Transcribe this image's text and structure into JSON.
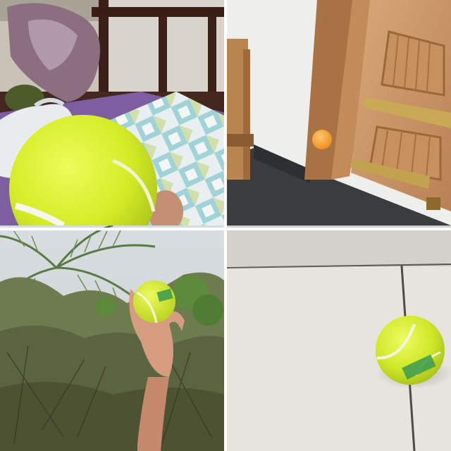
{
  "image": {
    "layout": "2x2-collage",
    "panels": [
      {
        "subject": "tennis-ball-in-hand-on-bed",
        "ball_color": "#d8ef2b"
      },
      {
        "subject": "orange-ball-near-wooden-door",
        "ball_color": "#f4a033"
      },
      {
        "subject": "hand-holding-tennis-ball-against-trees",
        "ball_color": "#d2ea2a"
      },
      {
        "subject": "tennis-ball-on-tiled-floor",
        "ball_color": "#cde82c"
      }
    ]
  }
}
